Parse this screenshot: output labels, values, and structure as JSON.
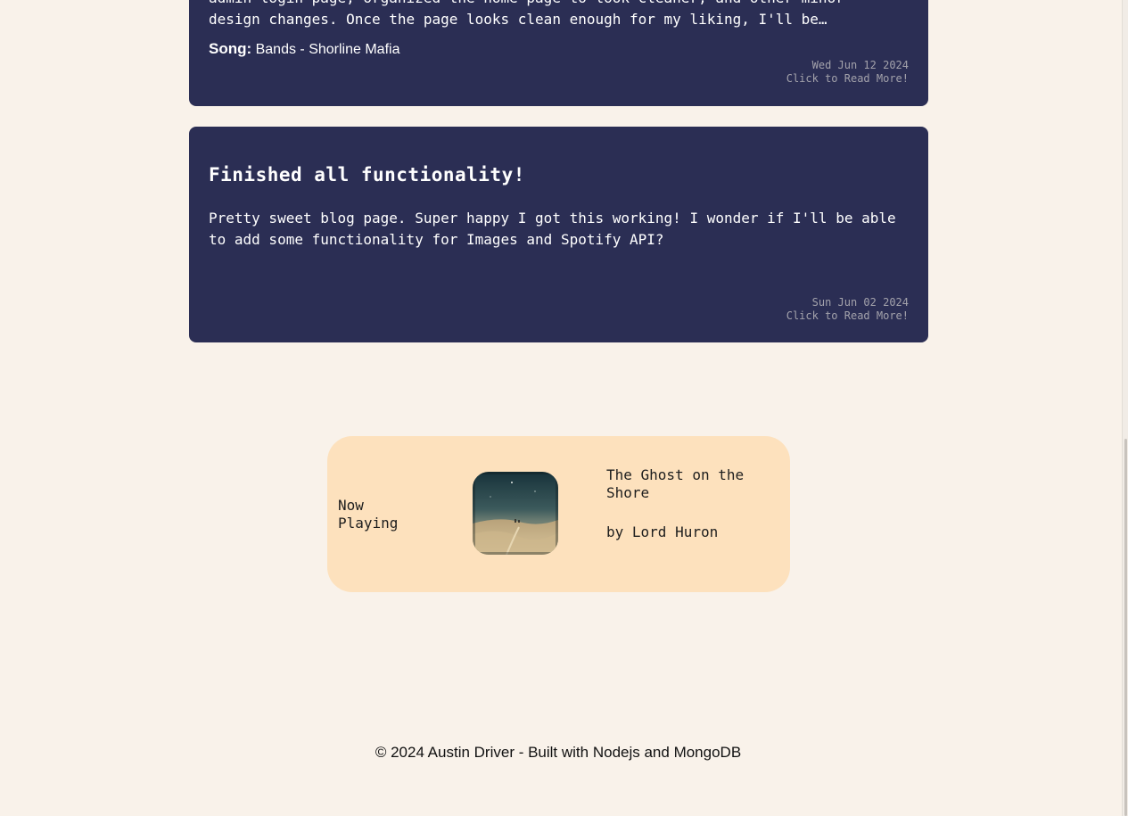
{
  "posts": [
    {
      "excerpt_lines": [
        "admin login page, organized the home page to look cleaner, and other minor",
        "design changes. Once the page looks clean enough for my liking, I'll be…"
      ],
      "song_label": "Song:",
      "song": "Bands - Shorline Mafia",
      "date": "Wed Jun 12 2024",
      "read_more": "Click to Read More!"
    },
    {
      "title": "Finished all functionality!",
      "excerpt": "Pretty sweet blog page. Super happy I got this working! I wonder if I'll be able to add some functionality for Images and Spotify API?",
      "date": "Sun Jun 02 2024",
      "read_more": "Click to Read More!"
    }
  ],
  "now_playing": {
    "label": "Now Playing",
    "track": "The Ghost on the Shore",
    "artist_line": "by Lord Huron",
    "album_art_icon": "desert-landscape-album-art"
  },
  "footer": {
    "text": "© 2024 Austin Driver - Built with Nodejs and MongoDB"
  },
  "colors": {
    "page_bg": "#f9f2ea",
    "card_bg": "#2b2e54",
    "now_playing_bg": "#fde1bd",
    "meta_text": "#a3a2ab"
  }
}
